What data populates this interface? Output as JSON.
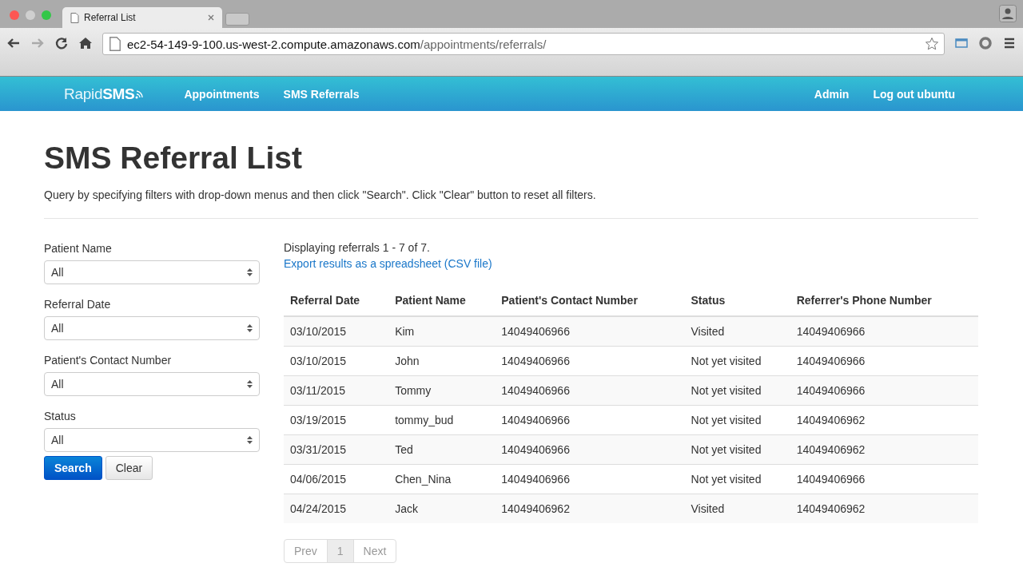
{
  "browser": {
    "tab_title": "Referral List",
    "url_host": "ec2-54-149-9-100.us-west-2.compute.amazonaws.com",
    "url_path": "/appointments/referrals/"
  },
  "navbar": {
    "logo": "Rapid**SMS**",
    "links": [
      {
        "label": "Appointments"
      },
      {
        "label": "SMS Referrals"
      }
    ],
    "right_links": [
      {
        "label": "Admin"
      },
      {
        "label": "Log out ubuntu"
      }
    ]
  },
  "title": "SMS Referral List",
  "description": "Query by specifying filters with drop-down menus and then click \"Search\". Click \"Clear\" button to reset all filters.",
  "filters": [
    {
      "label": "Patient Name",
      "value": "All"
    },
    {
      "label": "Referral Date",
      "value": "All"
    },
    {
      "label": "Patient's Contact Number",
      "value": "All"
    },
    {
      "label": "Status",
      "value": "All"
    }
  ],
  "buttons": [
    {
      "label": "Search",
      "kind": "primary"
    },
    {
      "label": "Clear",
      "kind": "default"
    }
  ],
  "summary": "Displaying referrals 1 - 7 of 7.",
  "export_link": "Export results as a spreadsheet (CSV file)",
  "table": {
    "columns": [
      "Referral Date",
      "Patient Name",
      "Patient's Contact Number",
      "Status",
      "Referrer's Phone Number"
    ],
    "rows": [
      [
        "03/10/2015",
        "Kim",
        "14049406966",
        "Visited",
        "14049406966"
      ],
      [
        "03/10/2015",
        "John",
        "14049406966",
        "Not yet visited",
        "14049406966"
      ],
      [
        "03/11/2015",
        "Tommy",
        "14049406966",
        "Not yet visited",
        "14049406966"
      ],
      [
        "03/19/2015",
        "tommy_bud",
        "14049406966",
        "Not yet visited",
        "14049406962"
      ],
      [
        "03/31/2015",
        "Ted",
        "14049406966",
        "Not yet visited",
        "14049406962"
      ],
      [
        "04/06/2015",
        "Chen_Nina",
        "14049406966",
        "Not yet visited",
        "14049406966"
      ],
      [
        "04/24/2015",
        "Jack",
        "14049406962",
        "Visited",
        "14049406962"
      ]
    ]
  },
  "pagination": [
    {
      "label": "Prev",
      "disabled": true,
      "selected": false
    },
    {
      "label": "1",
      "disabled": false,
      "selected": true
    },
    {
      "label": "Next",
      "disabled": true,
      "selected": false
    }
  ]
}
